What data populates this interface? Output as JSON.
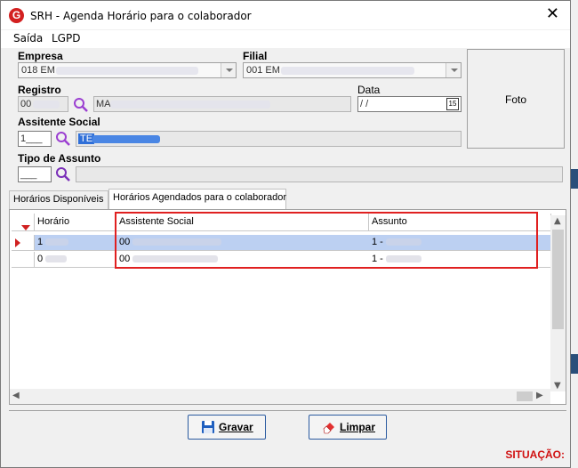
{
  "window": {
    "title": "SRH - Agenda Horário para o colaborador",
    "app_icon": "G"
  },
  "menu": [
    "Saída",
    "LGPD"
  ],
  "form": {
    "empresa_label": "Empresa",
    "empresa_value": "018 EM",
    "filial_label": "Filial",
    "filial_value": "001 EM",
    "registro_label": "Registro",
    "registro_code": "00",
    "registro_name": "MA",
    "data_label": "Data",
    "data_value": " /  /",
    "data_icon": "15",
    "assistente_label": "Assitente Social",
    "assistente_code": "1___",
    "assistente_name": "TE",
    "tipo_label": "Tipo de Assunto",
    "tipo_code": "___",
    "foto_label": "Foto"
  },
  "tabs": [
    {
      "label": "Horários Disponíveis",
      "active": false
    },
    {
      "label": "Horários Agendados para o colaborador",
      "active": true
    }
  ],
  "grid": {
    "columns": [
      "Horário",
      "Assistente Social",
      "Assunto"
    ],
    "rows": [
      {
        "horario": "1",
        "assistente": "00",
        "assunto": "1 -",
        "selected": true
      },
      {
        "horario": "0",
        "assistente": "00",
        "assunto": "1 -",
        "selected": false
      }
    ]
  },
  "buttons": {
    "gravar": "Gravar",
    "limpar": "Limpar"
  },
  "status": {
    "situacao": "SITUAÇÃO:"
  },
  "colors": {
    "highlight": "#e02020",
    "selected_row": "#bcd0f2",
    "accent": "#2a5aa0"
  }
}
